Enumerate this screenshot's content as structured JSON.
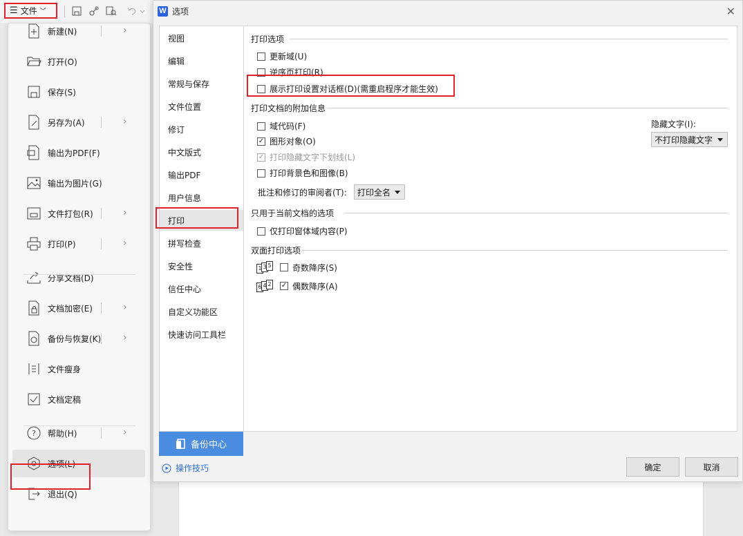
{
  "toolbar": {
    "file_label": "文件",
    "icons": [
      "menu-icon",
      "save-icon",
      "share-icon",
      "find-icon",
      "undo-icon",
      "dropdown-icon"
    ]
  },
  "file_menu": {
    "items": [
      {
        "label": "新建(N)",
        "icon": "new-file-icon",
        "has_sub": true
      },
      {
        "label": "打开(O)",
        "icon": "folder-open-icon",
        "has_sub": false
      },
      {
        "label": "保存(S)",
        "icon": "save-icon",
        "has_sub": false
      },
      {
        "label": "另存为(A)",
        "icon": "save-as-icon",
        "has_sub": true
      },
      {
        "label": "输出为PDF(F)",
        "icon": "pdf-export-icon",
        "has_sub": false
      },
      {
        "label": "输出为图片(G)",
        "icon": "image-export-icon",
        "has_sub": false
      },
      {
        "label": "文件打包(R)",
        "icon": "package-icon",
        "has_sub": true
      },
      {
        "label": "打印(P)",
        "icon": "print-icon",
        "has_sub": true
      },
      {
        "label": "分享文档(D)",
        "icon": "share-doc-icon",
        "has_sub": false
      },
      {
        "label": "文档加密(E)",
        "icon": "encrypt-icon",
        "has_sub": true
      },
      {
        "label": "备份与恢复(K)",
        "icon": "backup-icon",
        "has_sub": true
      },
      {
        "label": "文件瘦身",
        "icon": "slim-icon",
        "has_sub": false
      },
      {
        "label": "文档定稿",
        "icon": "finalize-icon",
        "has_sub": false
      },
      {
        "label": "帮助(H)",
        "icon": "help-icon",
        "has_sub": true
      },
      {
        "label": "选项(L)",
        "icon": "options-icon",
        "has_sub": false
      },
      {
        "label": "退出(Q)",
        "icon": "exit-icon",
        "has_sub": false
      }
    ]
  },
  "dialog": {
    "title": "选项",
    "nav": [
      "视图",
      "编辑",
      "常规与保存",
      "文件位置",
      "修订",
      "中文版式",
      "输出PDF",
      "用户信息",
      "打印",
      "拼写检查",
      "安全性",
      "信任中心",
      "自定义功能区",
      "快速访问工具栏"
    ],
    "active_nav": "打印",
    "backup_center": "备份中心",
    "tips": "操作技巧",
    "ok": "确定",
    "cancel": "取消",
    "sections": {
      "print_options": {
        "title": "打印选项",
        "update_fields": "更新域(U)",
        "reverse_print": "逆序页打印(R)",
        "show_dialog": "展示打印设置对话框(D)(需重启程序才能生效)"
      },
      "extra_info": {
        "title": "打印文档的附加信息",
        "field_codes": "域代码(F)",
        "drawing_objects": "图形对象(O)",
        "hidden_underline": "打印隐藏文字下划线(L)",
        "background": "打印背景色和图像(B)",
        "hidden_text_label": "隐藏文字(I):",
        "hidden_text_value": "不打印隐藏文字",
        "reviewer_label": "批注和修订的审阅者(T):",
        "reviewer_value": "打印全名"
      },
      "current_doc": {
        "title": "只用于当前文档的选项",
        "form_only": "仅打印窗体域内容(P)"
      },
      "duplex": {
        "title": "双面打印选项",
        "odd": "奇数降序(S)",
        "even": "偶数降序(A)",
        "odd_pages": [
          "1",
          "3",
          "5"
        ],
        "even_pages": [
          "6",
          "4",
          "2"
        ]
      }
    }
  },
  "checks": {
    "update_fields": false,
    "reverse_print": false,
    "show_dialog": false,
    "field_codes": false,
    "drawing_objects": true,
    "hidden_underline": true,
    "background": false,
    "form_only": false,
    "odd": false,
    "even": true
  },
  "colors": {
    "highlight": "#e0202a",
    "accent": "#4a8de0",
    "link": "#2f6fd0"
  }
}
